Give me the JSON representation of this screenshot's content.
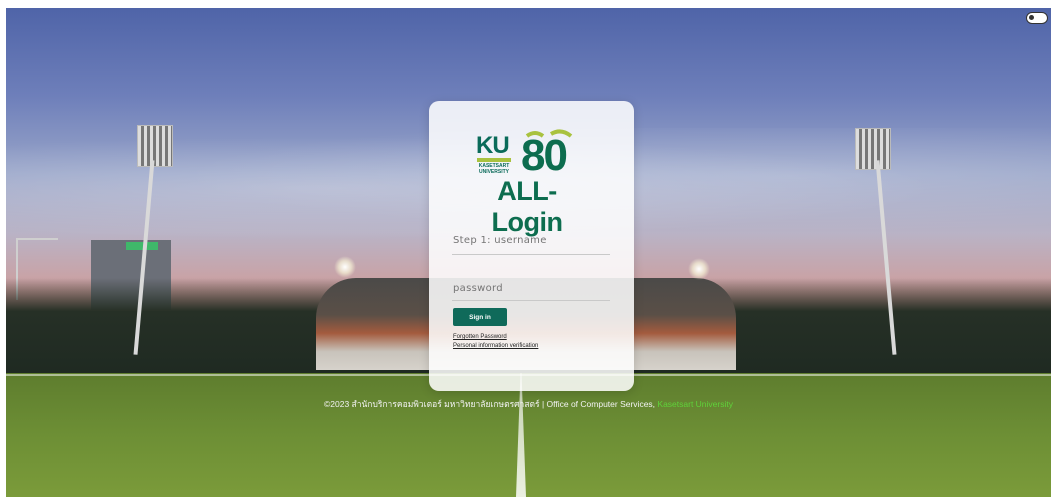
{
  "brand": {
    "ku_text": "KU",
    "ku_subtext": "KASETSART UNIVERSITY",
    "anniversary": "80",
    "title": "ALL-Login",
    "colors": {
      "primary": "#0f6a5a",
      "accent": "#a9c23f",
      "title": "#0d6d4f"
    }
  },
  "theme_toggle": {
    "icon": "toggle-icon"
  },
  "login": {
    "username_placeholder": "Step 1: username",
    "password_placeholder": "password",
    "signin_label": "Sign in",
    "forgot_link": "Forgotten Password",
    "verify_link": "Personal information verification"
  },
  "footer": {
    "text": "©2023 สำนักบริการคอมพิวเตอร์ มหาวิทยาลัยเกษตรศาสตร์ | Office of Computer Services, ",
    "university_link": "Kasetsart University",
    "link_color": "#5fd23a"
  }
}
